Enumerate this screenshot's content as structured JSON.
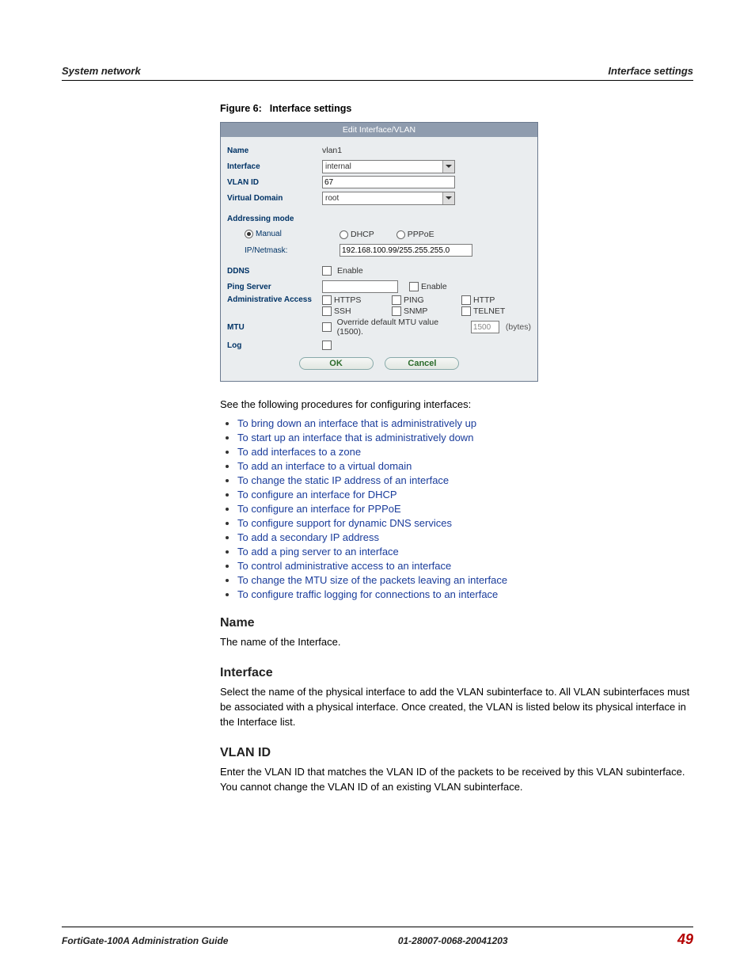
{
  "header": {
    "left": "System network",
    "right": "Interface settings"
  },
  "figure_caption_prefix": "Figure 6:",
  "figure_caption_text": "Interface settings",
  "ifbox": {
    "title": "Edit Interface/VLAN",
    "name_label": "Name",
    "name_value": "vlan1",
    "interface_label": "Interface",
    "interface_value": "internal",
    "vlanid_label": "VLAN ID",
    "vlanid_value": "67",
    "vdomain_label": "Virtual Domain",
    "vdomain_value": "root",
    "addrmode_label": "Addressing mode",
    "manual_label": "Manual",
    "dhcp_label": "DHCP",
    "pppoe_label": "PPPoE",
    "ipnetmask_label": "IP/Netmask:",
    "ipnetmask_value": "192.168.100.99/255.255.255.0",
    "ddns_label": "DDNS",
    "enable_label": "Enable",
    "pingserver_label": "Ping Server",
    "pingserver_value": "",
    "adminaccess_label": "Administrative Access",
    "https_label": "HTTPS",
    "ping_label": "PING",
    "http_label": "HTTP",
    "ssh_label": "SSH",
    "snmp_label": "SNMP",
    "telnet_label": "TELNET",
    "mtu_label": "MTU",
    "mtu_override_label": "Override default MTU value (1500).",
    "mtu_value": "1500",
    "mtu_unit": "(bytes)",
    "log_label": "Log",
    "ok_btn": "OK",
    "cancel_btn": "Cancel"
  },
  "intro_para": "See the following procedures for configuring interfaces:",
  "links": [
    "To bring down an interface that is administratively up",
    "To start up an interface that is administratively down",
    "To add interfaces to a zone",
    "To add an interface to a virtual domain",
    "To change the static IP address of an interface",
    "To configure an interface for DHCP",
    "To configure an interface for PPPoE",
    "To configure support for dynamic DNS services",
    "To add a secondary IP address",
    "To add a ping server to an interface",
    "To control administrative access to an interface",
    "To change the MTU size of the packets leaving an interface",
    "To configure traffic logging for connections to an interface"
  ],
  "sections": {
    "name_h": "Name",
    "name_p": "The name of the Interface.",
    "iface_h": "Interface",
    "iface_p": "Select the name of the physical interface to add the VLAN subinterface to. All VLAN subinterfaces must be associated with a physical interface. Once created, the VLAN is listed below its physical interface in the Interface list.",
    "vlan_h": "VLAN ID",
    "vlan_p": "Enter the VLAN ID that matches the VLAN ID of the packets to be received by this VLAN subinterface. You cannot change the VLAN ID of an existing VLAN subinterface."
  },
  "footer": {
    "left": "FortiGate-100A Administration Guide",
    "mid": "01-28007-0068-20041203",
    "pagenum": "49"
  }
}
